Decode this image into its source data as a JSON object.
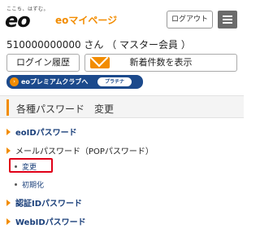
{
  "header": {
    "tagline": "ここち、はずむ。",
    "logo": "eo",
    "brand": "eoマイページ",
    "logout_label": "ログアウト",
    "menu_icon": "hamburger-menu-icon"
  },
  "user": {
    "id_line": "510000000000 さん （ マスター会員 ）"
  },
  "actions": {
    "login_history_label": "ログイン履歴",
    "new_mail_label": "新着件数を表示",
    "mail_icon": "mail-icon"
  },
  "premium": {
    "label": "eoプレミアムクラブへ",
    "badge": "プラチナ",
    "arrow_glyph": "›"
  },
  "section": {
    "title": "各種パスワード　変更"
  },
  "menu": {
    "eoid_password": "eoIDパスワード",
    "mail_password": "メールパスワード（POPパスワード）",
    "mail_sub_change": "変更",
    "mail_sub_init": "初期化",
    "auth_id_password": "認証IDパスワード",
    "webid_password": "WebIDパスワード"
  },
  "colors": {
    "accent_orange": "#f28c00",
    "navy": "#1c4a8c",
    "highlight_red": "#e00018"
  }
}
